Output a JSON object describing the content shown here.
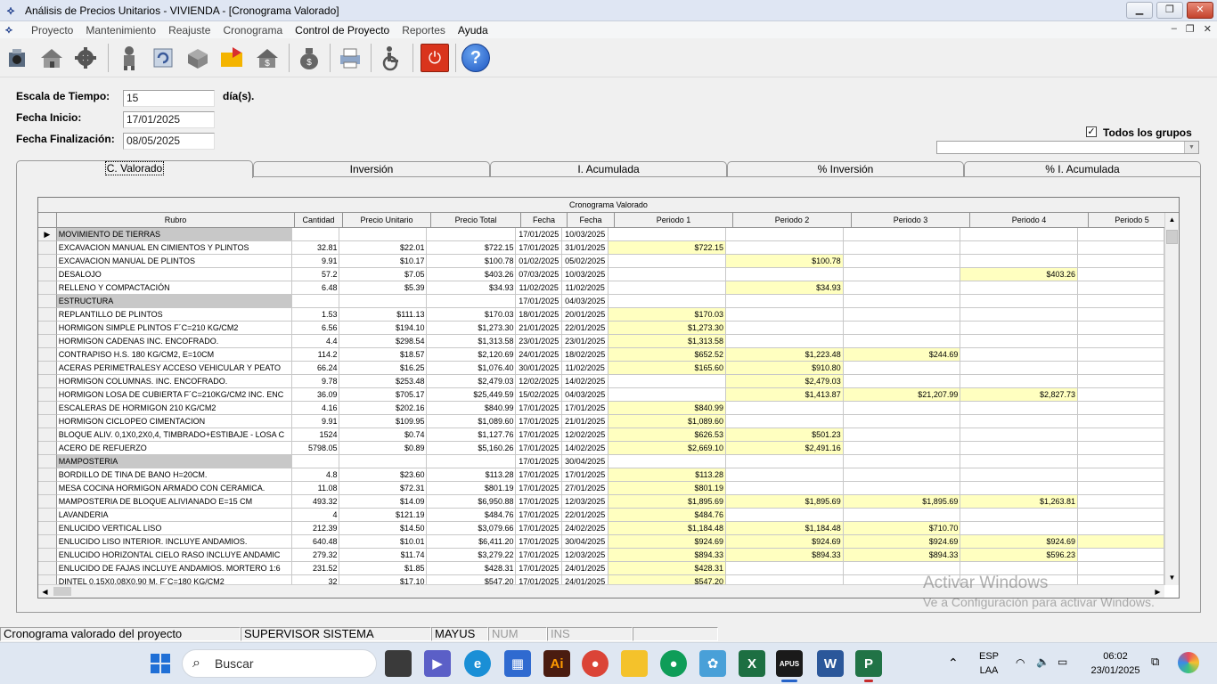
{
  "window": {
    "title": "Análisis de Precios Unitarios  -  VIVIENDA - [Cronograma Valorado]",
    "buttons": [
      "▁",
      "❐",
      "✕"
    ]
  },
  "menu": {
    "items": [
      "Proyecto",
      "Mantenimiento",
      "Reajuste",
      "Cronograma",
      "Control de Proyecto",
      "Reportes",
      "Ayuda"
    ],
    "mdi_controls": [
      "–",
      "❐",
      "✕"
    ]
  },
  "form": {
    "escala_label": "Escala de Tiempo:",
    "escala_value": "15",
    "escala_unit": "día(s).",
    "inicio_label": "Fecha Inicio:",
    "inicio_value": "17/01/2025",
    "fin_label": "Fecha Finalización:",
    "fin_value": "08/05/2025",
    "todos_label": "Todos los grupos",
    "todos_checked": true
  },
  "tabs": [
    "C. Valorado",
    "Inversión",
    "I. Acumulada",
    "% Inversión",
    "% I. Acumulada"
  ],
  "grid": {
    "caption": "Cronograma Valorado",
    "headers": [
      "Rubro",
      "Cantidad",
      "Precio Unitario",
      "Precio Total",
      "Fecha",
      "Fecha",
      "Periodo  1",
      "Periodo  2",
      "Periodo  3",
      "Periodo  4",
      "Periodo  5"
    ],
    "rows": [
      {
        "rubro": "MOVIMIENTO DE TIERRAS",
        "group": true,
        "cantidad": "",
        "pu": "",
        "pt": "",
        "f1": "17/01/2025",
        "f2": "10/03/2025",
        "p": [
          "",
          "",
          "",
          "",
          ""
        ],
        "current": true
      },
      {
        "rubro": "EXCAVACION MANUAL EN CIMIENTOS Y PLINTOS",
        "cantidad": "32.81",
        "pu": "$22.01",
        "pt": "$722.15",
        "f1": "17/01/2025",
        "f2": "31/01/2025",
        "p": [
          "$722.15",
          "",
          "",
          "",
          ""
        ]
      },
      {
        "rubro": "EXCAVACION MANUAL DE PLINTOS",
        "cantidad": "9.91",
        "pu": "$10.17",
        "pt": "$100.78",
        "f1": "01/02/2025",
        "f2": "05/02/2025",
        "p": [
          "",
          "$100.78",
          "",
          "",
          ""
        ]
      },
      {
        "rubro": "DESALOJO",
        "cantidad": "57.2",
        "pu": "$7.05",
        "pt": "$403.26",
        "f1": "07/03/2025",
        "f2": "10/03/2025",
        "p": [
          "",
          "",
          "",
          "$403.26",
          ""
        ]
      },
      {
        "rubro": "RELLENO Y COMPACTACIÓN",
        "cantidad": "6.48",
        "pu": "$5.39",
        "pt": "$34.93",
        "f1": "11/02/2025",
        "f2": "11/02/2025",
        "p": [
          "",
          "$34.93",
          "",
          "",
          ""
        ]
      },
      {
        "rubro": "ESTRUCTURA",
        "group": true,
        "cantidad": "",
        "pu": "",
        "pt": "",
        "f1": "17/01/2025",
        "f2": "04/03/2025",
        "p": [
          "",
          "",
          "",
          "",
          ""
        ]
      },
      {
        "rubro": "REPLANTILLO DE PLINTOS",
        "cantidad": "1.53",
        "pu": "$111.13",
        "pt": "$170.03",
        "f1": "18/01/2025",
        "f2": "20/01/2025",
        "p": [
          "$170.03",
          "",
          "",
          "",
          ""
        ]
      },
      {
        "rubro": "HORMIGON SIMPLE  PLINTOS F´C=210 KG/CM2",
        "cantidad": "6.56",
        "pu": "$194.10",
        "pt": "$1,273.30",
        "f1": "21/01/2025",
        "f2": "22/01/2025",
        "p": [
          "$1,273.30",
          "",
          "",
          "",
          ""
        ]
      },
      {
        "rubro": "HORMIGON CADENAS INC. ENCOFRADO.",
        "cantidad": "4.4",
        "pu": "$298.54",
        "pt": "$1,313.58",
        "f1": "23/01/2025",
        "f2": "23/01/2025",
        "p": [
          "$1,313.58",
          "",
          "",
          "",
          ""
        ]
      },
      {
        "rubro": "CONTRAPISO H.S. 180 KG/CM2, E=10CM",
        "cantidad": "114.2",
        "pu": "$18.57",
        "pt": "$2,120.69",
        "f1": "24/01/2025",
        "f2": "18/02/2025",
        "p": [
          "$652.52",
          "$1,223.48",
          "$244.69",
          "",
          ""
        ]
      },
      {
        "rubro": "ACERAS PERIMETRALESY ACCESO VEHICULAR Y PEATO",
        "cantidad": "66.24",
        "pu": "$16.25",
        "pt": "$1,076.40",
        "f1": "30/01/2025",
        "f2": "11/02/2025",
        "p": [
          "$165.60",
          "$910.80",
          "",
          "",
          ""
        ]
      },
      {
        "rubro": "HORMIGON COLUMNAS. INC. ENCOFRADO.",
        "cantidad": "9.78",
        "pu": "$253.48",
        "pt": "$2,479.03",
        "f1": "12/02/2025",
        "f2": "14/02/2025",
        "p": [
          "",
          "$2,479.03",
          "",
          "",
          ""
        ]
      },
      {
        "rubro": "HORMIGON LOSA DE CUBIERTA F´C=210KG/CM2 INC. ENC",
        "cantidad": "36.09",
        "pu": "$705.17",
        "pt": "$25,449.59",
        "f1": "15/02/2025",
        "f2": "04/03/2025",
        "p": [
          "",
          "$1,413.87",
          "$21,207.99",
          "$2,827.73",
          ""
        ]
      },
      {
        "rubro": "ESCALERAS DE HORMIGON 210 KG/CM2",
        "cantidad": "4.16",
        "pu": "$202.16",
        "pt": "$840.99",
        "f1": "17/01/2025",
        "f2": "17/01/2025",
        "p": [
          "$840.99",
          "",
          "",
          "",
          ""
        ]
      },
      {
        "rubro": "HORMIGON CICLOPEO CIMENTACION",
        "cantidad": "9.91",
        "pu": "$109.95",
        "pt": "$1,089.60",
        "f1": "17/01/2025",
        "f2": "21/01/2025",
        "p": [
          "$1,089.60",
          "",
          "",
          "",
          ""
        ]
      },
      {
        "rubro": "BLOQUE ALIV. 0,1X0,2X0,4, TIMBRADO+ESTIBAJE - LOSA C",
        "cantidad": "1524",
        "pu": "$0.74",
        "pt": "$1,127.76",
        "f1": "17/01/2025",
        "f2": "12/02/2025",
        "p": [
          "$626.53",
          "$501.23",
          "",
          "",
          ""
        ]
      },
      {
        "rubro": "ACERO DE REFUERZO",
        "cantidad": "5798.05",
        "pu": "$0.89",
        "pt": "$5,160.26",
        "f1": "17/01/2025",
        "f2": "14/02/2025",
        "p": [
          "$2,669.10",
          "$2,491.16",
          "",
          "",
          ""
        ]
      },
      {
        "rubro": "MAMPOSTERIA",
        "group": true,
        "cantidad": "",
        "pu": "",
        "pt": "",
        "f1": "17/01/2025",
        "f2": "30/04/2025",
        "p": [
          "",
          "",
          "",
          "",
          ""
        ]
      },
      {
        "rubro": "BORDILLO DE TINA DE BANO H=20CM.",
        "cantidad": "4.8",
        "pu": "$23.60",
        "pt": "$113.28",
        "f1": "17/01/2025",
        "f2": "17/01/2025",
        "p": [
          "$113.28",
          "",
          "",
          "",
          ""
        ]
      },
      {
        "rubro": "MESA COCINA HORMIGON ARMADO CON CERAMICA.",
        "cantidad": "11.08",
        "pu": "$72.31",
        "pt": "$801.19",
        "f1": "17/01/2025",
        "f2": "27/01/2025",
        "p": [
          "$801.19",
          "",
          "",
          "",
          ""
        ]
      },
      {
        "rubro": "MAMPOSTERIA DE BLOQUE ALIVIANADO E=15 CM",
        "cantidad": "493.32",
        "pu": "$14.09",
        "pt": "$6,950.88",
        "f1": "17/01/2025",
        "f2": "12/03/2025",
        "p": [
          "$1,895.69",
          "$1,895.69",
          "$1,895.69",
          "$1,263.81",
          ""
        ]
      },
      {
        "rubro": "LAVANDERIA",
        "cantidad": "4",
        "pu": "$121.19",
        "pt": "$484.76",
        "f1": "17/01/2025",
        "f2": "22/01/2025",
        "p": [
          "$484.76",
          "",
          "",
          "",
          ""
        ]
      },
      {
        "rubro": "ENLUCIDO VERTICAL LISO",
        "cantidad": "212.39",
        "pu": "$14.50",
        "pt": "$3,079.66",
        "f1": "17/01/2025",
        "f2": "24/02/2025",
        "p": [
          "$1,184.48",
          "$1,184.48",
          "$710.70",
          "",
          ""
        ]
      },
      {
        "rubro": "ENLUCIDO LISO INTERIOR. INCLUYE ANDAMIOS.",
        "cantidad": "640.48",
        "pu": "$10.01",
        "pt": "$6,411.20",
        "f1": "17/01/2025",
        "f2": "30/04/2025",
        "p": [
          "$924.69",
          "$924.69",
          "$924.69",
          "$924.69",
          ""
        ],
        "hl5": true
      },
      {
        "rubro": "ENLUCIDO HORIZONTAL CIELO RASO INCLUYE ANDAMIC",
        "cantidad": "279.32",
        "pu": "$11.74",
        "pt": "$3,279.22",
        "f1": "17/01/2025",
        "f2": "12/03/2025",
        "p": [
          "$894.33",
          "$894.33",
          "$894.33",
          "$596.23",
          ""
        ]
      },
      {
        "rubro": "ENLUCIDO DE FAJAS INCLUYE ANDAMIOS. MORTERO 1:6",
        "cantidad": "231.52",
        "pu": "$1.85",
        "pt": "$428.31",
        "f1": "17/01/2025",
        "f2": "24/01/2025",
        "p": [
          "$428.31",
          "",
          "",
          "",
          ""
        ]
      },
      {
        "rubro": "DINTEL 0.15X0.08X0,90 M, F´C=180 KG/CM2",
        "cantidad": "32",
        "pu": "$17.10",
        "pt": "$547.20",
        "f1": "17/01/2025",
        "f2": "24/01/2025",
        "p": [
          "$547.20",
          "",
          "",
          "",
          ""
        ]
      }
    ]
  },
  "watermark": {
    "line1": "Activar Windows",
    "line2": "Ve a Configuración para activar Windows."
  },
  "status": {
    "message": "Cronograma valorado del proyecto",
    "user": "SUPERVISOR SISTEMA",
    "mayus": "MAYUS",
    "num": "NUM",
    "ins": "INS"
  },
  "taskbar": {
    "search_placeholder": "Buscar",
    "lang1": "ESP",
    "lang2": "LAA",
    "time": "06:02",
    "date": "23/01/2025"
  },
  "colors": {
    "highlight_cell": "#ffffc0",
    "group_row": "#c8c8c8",
    "accent": "#2563c9"
  }
}
